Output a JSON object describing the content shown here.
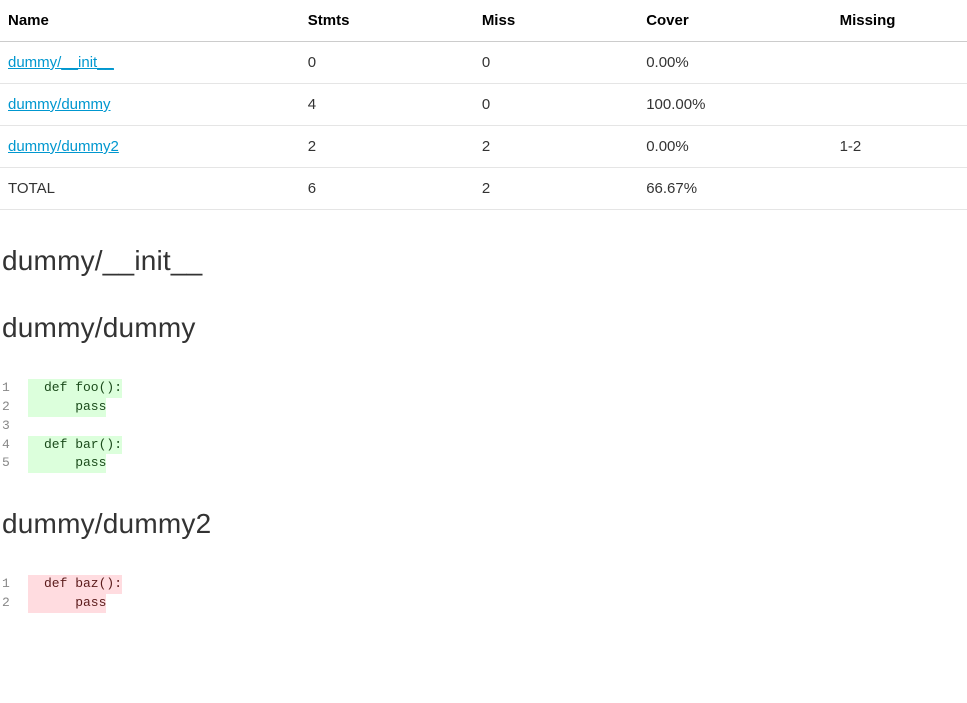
{
  "table": {
    "headers": {
      "name": "Name",
      "stmts": "Stmts",
      "miss": "Miss",
      "cover": "Cover",
      "missing": "Missing"
    },
    "rows": [
      {
        "name": "dummy/__init__",
        "stmts": "0",
        "miss": "0",
        "cover": "0.00%",
        "missing": ""
      },
      {
        "name": "dummy/dummy",
        "stmts": "4",
        "miss": "0",
        "cover": "100.00%",
        "missing": ""
      },
      {
        "name": "dummy/dummy2",
        "stmts": "2",
        "miss": "2",
        "cover": "0.00%",
        "missing": "1-2"
      }
    ],
    "total": {
      "name": "TOTAL",
      "stmts": "6",
      "miss": "2",
      "cover": "66.67%",
      "missing": ""
    }
  },
  "sections": [
    {
      "title": "dummy/__init__",
      "lines": []
    },
    {
      "title": "dummy/dummy",
      "lines": [
        {
          "n": "1",
          "text": "def foo():",
          "status": "hit"
        },
        {
          "n": "2",
          "text": "    pass",
          "status": "hit"
        },
        {
          "n": "3",
          "text": "",
          "status": "none"
        },
        {
          "n": "4",
          "text": "def bar():",
          "status": "hit"
        },
        {
          "n": "5",
          "text": "    pass",
          "status": "hit"
        }
      ]
    },
    {
      "title": "dummy/dummy2",
      "lines": [
        {
          "n": "1",
          "text": "def baz():",
          "status": "miss"
        },
        {
          "n": "2",
          "text": "    pass",
          "status": "miss"
        }
      ]
    }
  ]
}
